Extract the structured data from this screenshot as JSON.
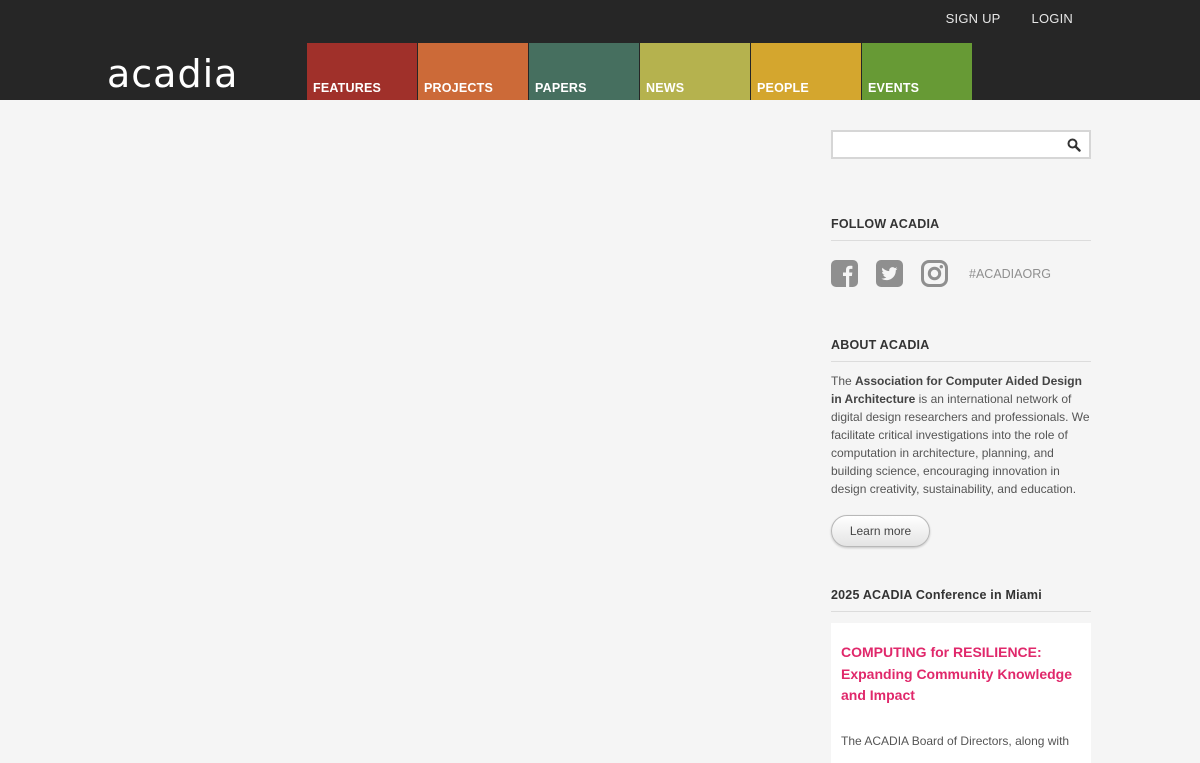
{
  "header": {
    "logo": "acadia",
    "top_links": {
      "signup": "SIGN UP",
      "login": "LOGIN"
    },
    "nav": [
      {
        "label": "FEATURES",
        "color": "#a0302a"
      },
      {
        "label": "PROJECTS",
        "color": "#cc6a38"
      },
      {
        "label": "PAPERS",
        "color": "#466f5f"
      },
      {
        "label": "NEWS",
        "color": "#b5b24e"
      },
      {
        "label": "PEOPLE",
        "color": "#d4a62e"
      },
      {
        "label": "EVENTS",
        "color": "#679a35"
      }
    ]
  },
  "sidebar": {
    "search": {
      "value": "",
      "placeholder": "",
      "icon": "search-icon"
    },
    "follow": {
      "title": "FOLLOW ACADIA",
      "icons": [
        "facebook-icon",
        "twitter-icon",
        "instagram-icon"
      ],
      "hashtag": "#ACADIAORG"
    },
    "about": {
      "title": "ABOUT ACADIA",
      "text_before": "The ",
      "text_bold": "Association for Computer Aided Design in Architecture",
      "text_after": " is an international network of digital design researchers and professionals. We facilitate critical investigations into the role of computation in architecture, planning, and building science, encouraging innovation in design creativity, sustainability, and education.",
      "button": "Learn more"
    },
    "conference": {
      "title": "2025 ACADIA Conference in Miami",
      "heading": "COMPUTING for RESILIENCE: Expanding Community Knowledge and Impact",
      "text": "The ACADIA Board of Directors, along with"
    }
  },
  "colors": {
    "header_bg": "#262626",
    "page_bg": "#f5f5f5",
    "accent_pink": "#e0286b",
    "icon_gray": "#8f8f8f"
  }
}
